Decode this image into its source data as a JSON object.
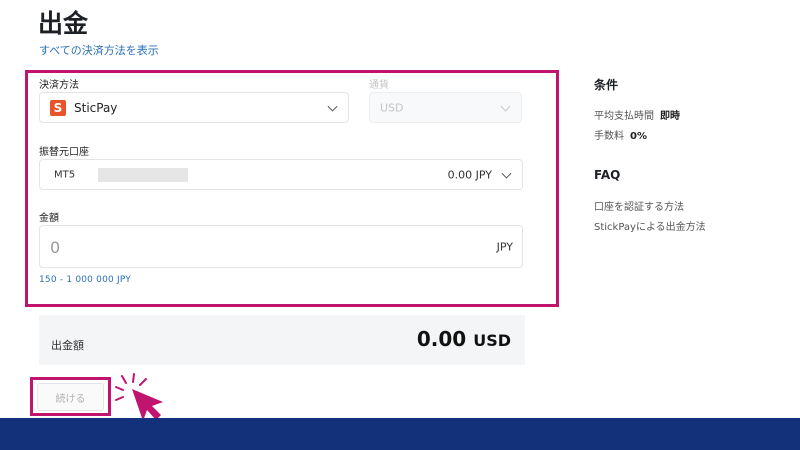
{
  "page": {
    "title": "出金",
    "all_methods_link": "すべての決済方法を表示"
  },
  "form": {
    "payment_method": {
      "label": "決済方法",
      "value": "SticPay",
      "icon_letter": "S"
    },
    "currency": {
      "label": "通貨",
      "value": "USD"
    },
    "source_account": {
      "label": "振替元口座",
      "platform": "MT5",
      "balance": "0.00 JPY"
    },
    "amount": {
      "label": "金額",
      "placeholder": "0",
      "unit": "JPY",
      "range": "150 - 1 000 000 JPY"
    }
  },
  "summary": {
    "label": "出金額",
    "value": "0.00",
    "currency": "USD"
  },
  "actions": {
    "continue_label": "続ける"
  },
  "sidebar": {
    "conditions_heading": "条件",
    "avg_time_label": "平均支払時間",
    "avg_time_value": "即時",
    "fee_label": "手数料",
    "fee_value": "0%",
    "faq_heading": "FAQ",
    "faq_links": [
      "口座を認証する方法",
      "StickPayによる出金方法"
    ]
  },
  "colors": {
    "highlight": "#c0146e",
    "footer": "#13307a",
    "link": "#2a6fb5",
    "sticpay_orange": "#e8552a"
  }
}
